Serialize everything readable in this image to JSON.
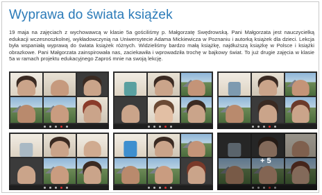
{
  "article": {
    "title": "Wyprawa do świata książek",
    "paragraph": "19 maja na zajęciach z wychowawcą w klasie 5a gościliśmy p. Małgorzatę Swędrowską. Pani Małgorzata jest nauczycielką edukacji wczesnoszkolnej, wykładowczynią na Uniwersytecie Adama Mickiewicza w Poznaniu i autorką książek dla dzieci. Lekcja była wspaniałą wyprawą do świata książek różnych. Widzieliśmy bardzo małą książkę, najdłuższą książkę w Polsce i książki obrazkowe. Pani Małgorzata zainspirowała nas, zaciekawiła i wprowadziła trochę w bajkowy świat. To już drugie zajęcia w klasie 5a w ramach projektu edukacyjnego Zaproś mnie na swoją lekcję."
  },
  "gallery": {
    "more_label": "+ 5",
    "photos": [
      {
        "alt": ""
      },
      {
        "alt": ""
      },
      {
        "alt": ""
      },
      {
        "alt": ""
      },
      {
        "alt": ""
      },
      {
        "alt": ""
      }
    ]
  }
}
